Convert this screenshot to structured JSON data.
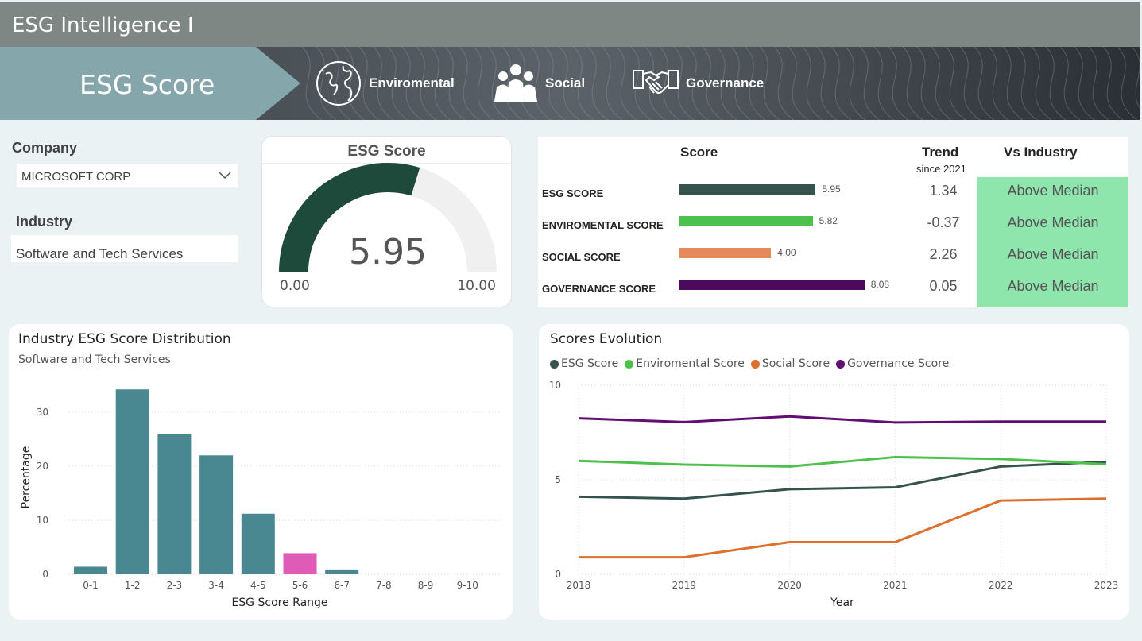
{
  "app": {
    "title": "ESG Intelligence I"
  },
  "nav": {
    "active": "ESG Score",
    "tabs": [
      {
        "label": "Enviromental",
        "icon": "globe-icon"
      },
      {
        "label": "Social",
        "icon": "people-icon"
      },
      {
        "label": "Governance",
        "icon": "handshake-icon"
      }
    ]
  },
  "filters": {
    "company_label": "Company",
    "company_value": "MICROSOFT CORP",
    "industry_label": "Industry",
    "industry_value": "Software and Tech Services"
  },
  "gauge": {
    "title": "ESG Score",
    "value": 5.95,
    "value_label": "5.95",
    "min_label": "0.00",
    "max_label": "10.00",
    "min": 0,
    "max": 10,
    "fill_color": "#1e4a3b",
    "track_color": "#f0f0f0"
  },
  "score_table": {
    "headers": {
      "score": "Score",
      "trend": "Trend",
      "trend_sub": "since 2021",
      "vs": "Vs Industry"
    },
    "max": 10,
    "rows": [
      {
        "label": "ESG SCORE",
        "value": 5.95,
        "value_label": "5.95",
        "trend": "1.34",
        "vs": "Above Median",
        "color": "#36524c"
      },
      {
        "label": "ENVIROMENTAL SCORE",
        "value": 5.82,
        "value_label": "5.82",
        "trend": "-0.37",
        "vs": "Above Median",
        "color": "#4cc14c"
      },
      {
        "label": "SOCIAL SCORE",
        "value": 4.0,
        "value_label": "4.00",
        "trend": "2.26",
        "vs": "Above Median",
        "color": "#e6895a"
      },
      {
        "label": "GOVERNANCE SCORE",
        "value": 8.08,
        "value_label": "8.08",
        "trend": "0.05",
        "vs": "Above Median",
        "color": "#4d0a5c"
      }
    ]
  },
  "chart_data": [
    {
      "type": "bar",
      "title": "Industry ESG Score Distribution",
      "subtitle": "Software and Tech Services",
      "xlabel": "ESG Score Range",
      "ylabel": "Percentage",
      "categories": [
        "0-1",
        "1-2",
        "2-3",
        "3-4",
        "4-5",
        "5-6",
        "6-7",
        "7-8",
        "8-9",
        "9-10"
      ],
      "values": [
        1.4,
        34.2,
        25.9,
        22.0,
        11.2,
        3.9,
        0.9,
        0,
        0,
        0
      ],
      "highlight_index": 5,
      "bar_color": "#4a8891",
      "highlight_color": "#e05bb8",
      "ylim": [
        0,
        36
      ],
      "yticks": [
        0,
        10,
        20,
        30
      ],
      "grid": true
    },
    {
      "type": "line",
      "title": "Scores Evolution",
      "xlabel": "Year",
      "ylabel": "",
      "x": [
        "2018",
        "2019",
        "2020",
        "2021",
        "2022",
        "2023"
      ],
      "ylim": [
        0,
        10
      ],
      "yticks": [
        0,
        5,
        10
      ],
      "legend_position": "top-left",
      "grid": true,
      "series": [
        {
          "name": "ESG Score",
          "color": "#36524c",
          "values": [
            4.1,
            4.0,
            4.5,
            4.6,
            5.7,
            5.95
          ]
        },
        {
          "name": "Enviromental Score",
          "color": "#4cc14c",
          "values": [
            6.0,
            5.8,
            5.7,
            6.2,
            6.1,
            5.82
          ]
        },
        {
          "name": "Social Score",
          "color": "#dd6f2f",
          "values": [
            0.9,
            0.9,
            1.7,
            1.7,
            3.9,
            4.0
          ]
        },
        {
          "name": "Governance Score",
          "color": "#620d73",
          "values": [
            8.25,
            8.05,
            8.35,
            8.03,
            8.08,
            8.08
          ]
        }
      ]
    }
  ]
}
